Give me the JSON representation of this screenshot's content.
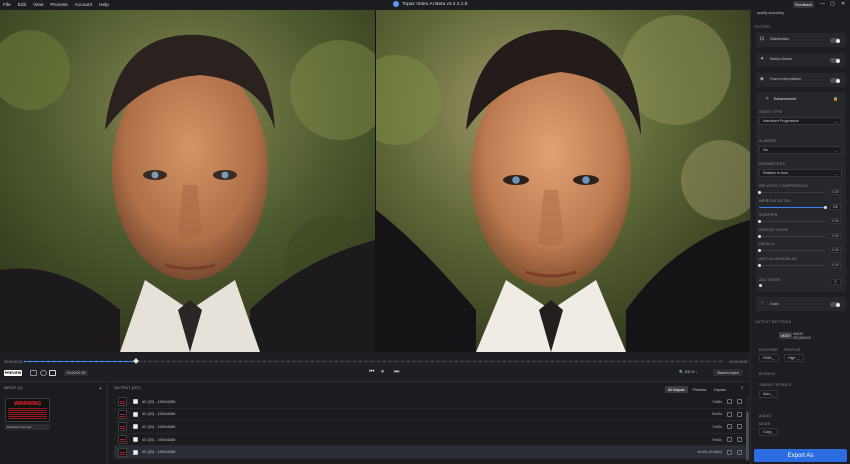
{
  "menu": [
    "File",
    "Edit",
    "View",
    "Process",
    "Account",
    "Help"
  ],
  "app_title": "Topaz Video AI Beta  v3.4.2.1.b",
  "feedback_label": "Feedback",
  "window_controls": [
    "—",
    "▢",
    "✕"
  ],
  "timeline": {
    "start_tc": "00:00:00:00",
    "end_tc": "00:00:09:00",
    "progress": 0.16,
    "preview_label": "PREVIEW",
    "current_tc": "01:00:07:20",
    "zoom_label": "100  %",
    "back_to_input": "Back to Input"
  },
  "input_pane": {
    "label": "INPUT (1)",
    "thumb_title": "WARNING",
    "file_name": "Directors Cut.mp4"
  },
  "output_pane": {
    "label": "OUTPUT (5/7)",
    "tabs": [
      "All Outputs",
      "Previews",
      "Exports"
    ],
    "rows": [
      {
        "label": "4C (3X) - 1920x1080",
        "size": "7m55s"
      },
      {
        "label": "4C (3X) - 1920x1080",
        "size": "8m19s"
      },
      {
        "label": "4C (3X) - 1920x1080",
        "size": "7m02s"
      },
      {
        "label": "4C (3X) - 1920x1080",
        "size": "7m44s"
      },
      {
        "label": "4C (3X) - 1920x1080",
        "size": "6m45s (5.43fps)"
      }
    ]
  },
  "sidebar": {
    "top_note": "quality upscaling",
    "filters_head": "FILTERS",
    "stabilization": "Stabilization",
    "motion_deblur": "Motion Deblur",
    "frame_interp": "Frame Interpolation",
    "enhancement": "Enhancement",
    "video_type_head": "VIDEO TYPE",
    "video_type": "Interlaced Progressive",
    "ai_model_head": "AI MODEL",
    "ai_model": "Iris",
    "parameters_head": "PARAMETERS",
    "parameters": "Relative to Auto",
    "sliders": [
      {
        "label": "RECOVER COMPRESSION",
        "value": "0.00",
        "level": 0.0
      },
      {
        "label": "IMPROVE DETAIL",
        "value": "100",
        "level": 1.0
      },
      {
        "label": "SHARPEN",
        "value": "0.00",
        "level": 0.0
      },
      {
        "label": "REDUCE NOISE",
        "value": "0.00",
        "level": 0.0
      },
      {
        "label": "DEHALO",
        "value": "0.00",
        "level": 0.0
      },
      {
        "label": "ANTI-ALIAS/DEBLUR",
        "value": "0.00",
        "level": 0.0
      }
    ],
    "add_noise_head": "ADD NOISE",
    "add_noise_value": "0",
    "grain": "Grain",
    "output_settings_head": "OUTPUT SETTINGS",
    "seg_video": "VIDEO",
    "seg_image": "IMAGE SEQUENCE",
    "encoder_head": "ENCODER",
    "encoder": "H264",
    "profile_head": "PROFILE",
    "profile": "High",
    "bitrate_head": "BITRATE",
    "target_bitrate_head": "TARGET BITRATE",
    "bitrate": "Auto",
    "audio_head": "AUDIO",
    "mode_head": "MODE",
    "mode": "Copy",
    "export_label": "Export As"
  },
  "colors": {
    "accent": "#3b82f6",
    "export": "#2b6de0",
    "warning": "#e0202a"
  }
}
